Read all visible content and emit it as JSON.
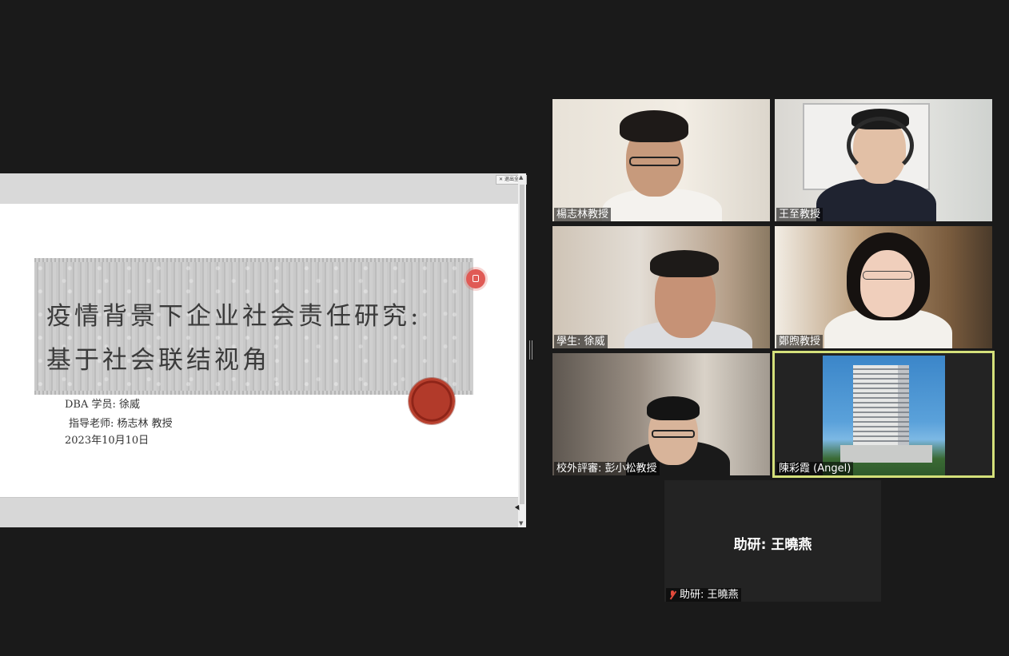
{
  "share": {
    "exit_label": "退出全屏",
    "slide": {
      "title_line1": "疫情背景下企业社会责任研究:",
      "title_line2": "基于社会联结视角",
      "student": "DBA 学员:  徐威",
      "advisor": "指导老师:  杨志林  教授",
      "date": "2023年10月10日"
    }
  },
  "participants": [
    {
      "name": "楊志林教授"
    },
    {
      "name": "王至教授"
    },
    {
      "name": "學生: 徐威"
    },
    {
      "name": "鄭煦教授"
    },
    {
      "name": "校外評審: 彭小松教授"
    },
    {
      "name": "陳彩霞 (Angel)"
    },
    {
      "name": "助研: 王曉燕",
      "center_label": "助研: 王曉燕",
      "muted": true
    }
  ],
  "colors": {
    "background": "#1a1a1a",
    "active_speaker_border": "#d4e07a",
    "muted_icon": "#e24a3b"
  }
}
